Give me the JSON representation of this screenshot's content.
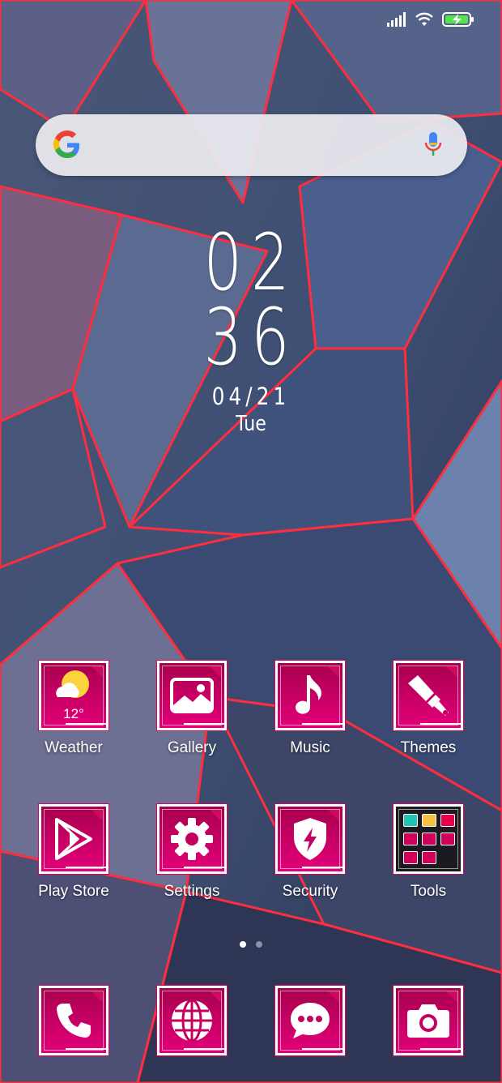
{
  "colors": {
    "tile_top": "#a8004e",
    "tile_bottom": "#e40079",
    "accent": "#ff2a3a"
  },
  "status_bar": {
    "icons": [
      "signal-icon",
      "wifi-icon",
      "battery-charging-icon"
    ]
  },
  "search": {
    "icons": [
      "google-logo-icon",
      "microphone-icon"
    ]
  },
  "clock": {
    "hour": "02",
    "minute": "36",
    "date": "04/21",
    "day": "Tue"
  },
  "apps": [
    {
      "label": "Weather",
      "icon": "weather-icon",
      "temp": "12°"
    },
    {
      "label": "Gallery",
      "icon": "gallery-icon"
    },
    {
      "label": "Music",
      "icon": "music-note-icon"
    },
    {
      "label": "Themes",
      "icon": "paintbrush-icon"
    },
    {
      "label": "Play Store",
      "icon": "play-store-icon"
    },
    {
      "label": "Settings",
      "icon": "gear-icon"
    },
    {
      "label": "Security",
      "icon": "shield-icon"
    },
    {
      "label": "Tools",
      "icon": "folder-icon"
    }
  ],
  "page_indicator": {
    "pages": 2,
    "current": 1
  },
  "dock": [
    {
      "icon": "phone-icon"
    },
    {
      "icon": "globe-icon"
    },
    {
      "icon": "message-icon"
    },
    {
      "icon": "camera-icon"
    }
  ]
}
